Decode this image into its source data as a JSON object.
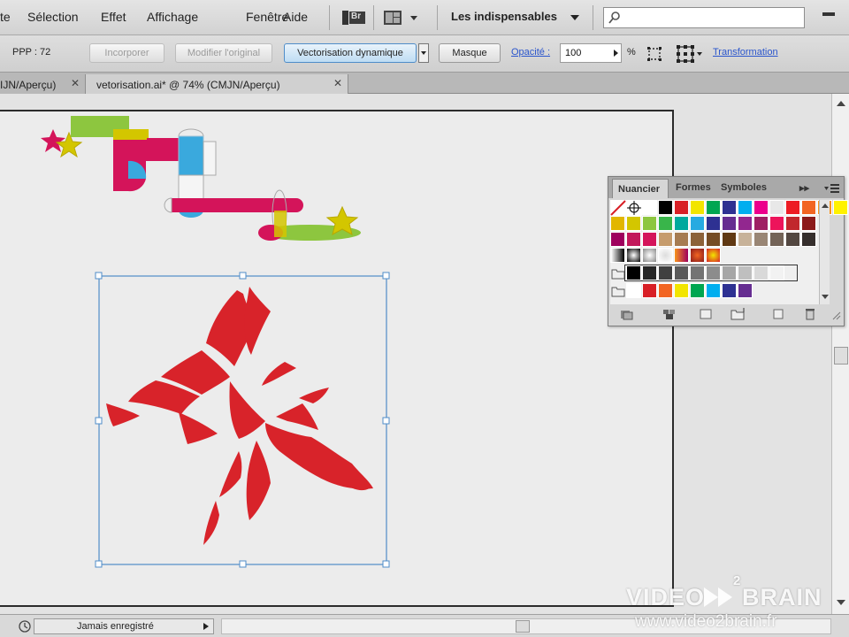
{
  "menu": {
    "items": [
      "te",
      "Sélection",
      "Effet",
      "Affichage",
      "Fenêtre",
      "Aide"
    ],
    "bridge_label": "Br",
    "workspace": "Les indispensables"
  },
  "control": {
    "ppp_label": "PPP : 72",
    "incorporer": "Incorporer",
    "modifier": "Modifier l'original",
    "vectorisation": "Vectorisation dynamique",
    "masque": "Masque",
    "opacite_label": "Opacité :",
    "opacite_value": "100",
    "percent": "%",
    "transformation": "Transformation"
  },
  "tabs": [
    {
      "label": "IJN/Aperçu)"
    },
    {
      "label": "vetorisation.ai* @ 74% (CMJN/Aperçu)"
    }
  ],
  "tab_close": "✕",
  "panel": {
    "tabs": [
      "Nuancier",
      "Formes",
      "Symboles"
    ],
    "menu_glyph": "▸▸",
    "colors": {
      "row1": [
        "#ffffff",
        "#000000",
        "#d81f26",
        "#f2e500",
        "#00a651",
        "#2e3192",
        "#00aeef",
        "#ec008c",
        "#e8e8e8",
        "#ed1c24",
        "#f26522",
        "#f7941d",
        "#fff200"
      ],
      "row2": [
        "#e2b600",
        "#d3c600",
        "#8dc63f",
        "#39b54a",
        "#00a99d",
        "#27aae1",
        "#2e3192",
        "#662d91",
        "#92278f",
        "#9e1f63",
        "#ed145b",
        "#c1272d",
        "#8b1a1a"
      ],
      "row3": [
        "#9e005d",
        "#c2185b",
        "#d4145a",
        "#c69c6d",
        "#a67c52",
        "#8c6239",
        "#754c24",
        "#603913",
        "#c7b299",
        "#998675",
        "#736357",
        "#534741",
        "#362f2d"
      ],
      "row5": [
        "#000000",
        "#262626",
        "#404040",
        "#595959",
        "#737373",
        "#8c8c8c",
        "#a6a6a6",
        "#bfbfbf",
        "#d9d9d9",
        "#f2f2f2"
      ],
      "row6": [
        "#ffffff",
        "#d81f26",
        "#f26522",
        "#f2e500",
        "#00a651",
        "#00aeef",
        "#2e3192",
        "#662d91"
      ]
    }
  },
  "status": {
    "saved": "Jamais enregistré"
  },
  "watermark": {
    "line1a": "VIDEO",
    "line1b": "BRAIN",
    "sup": "2",
    "url": "www.video2brain.fr"
  },
  "accent": "#4f8dc9",
  "art_red": "#d8232a"
}
